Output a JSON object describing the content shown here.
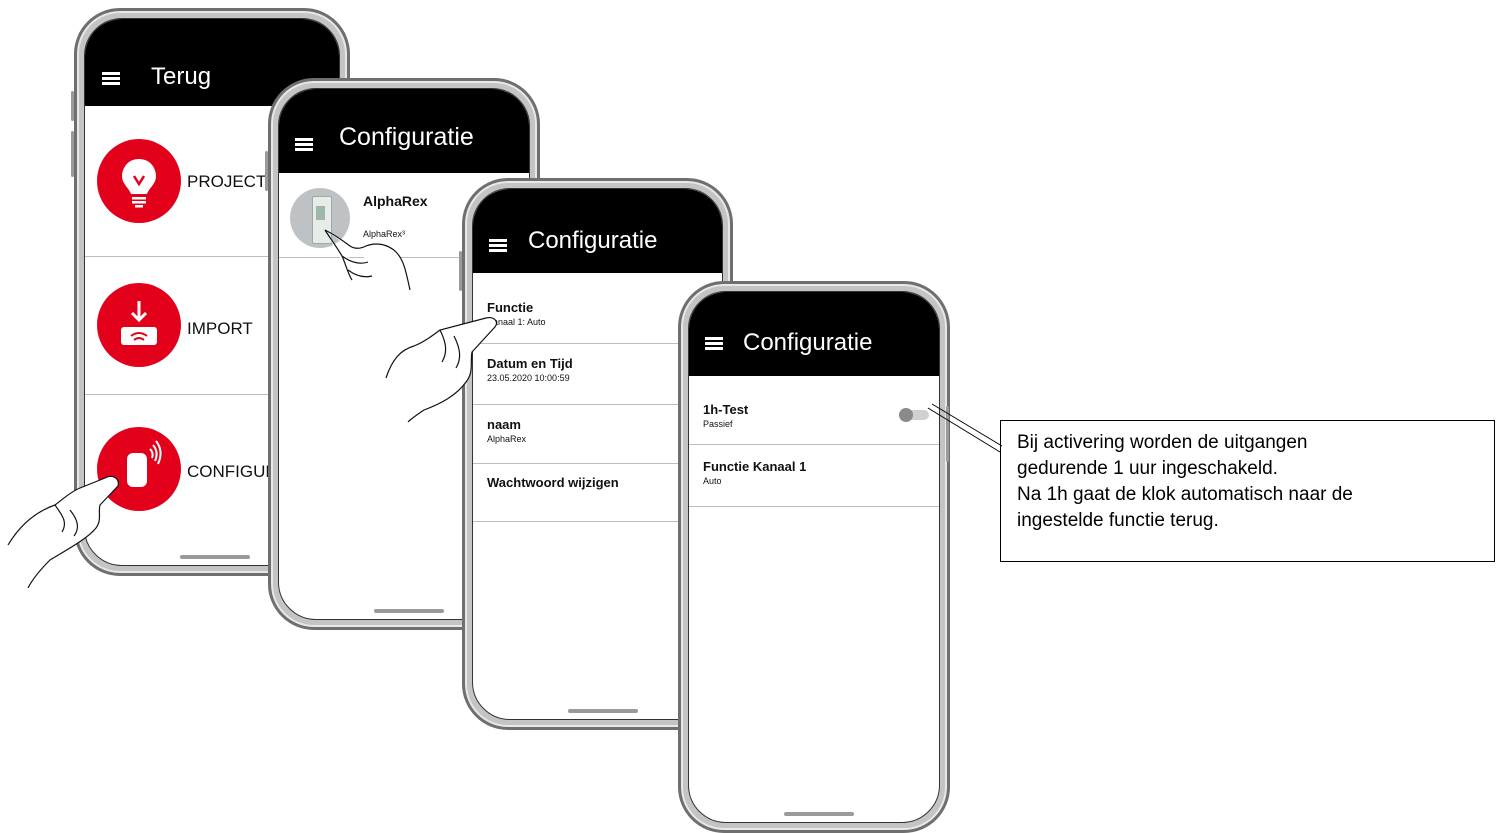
{
  "phone1": {
    "title": "Terug",
    "items": [
      {
        "label": "PROJECTEN",
        "icon": "lightbulb-icon"
      },
      {
        "label": "IMPORT",
        "icon": "download-router-icon"
      },
      {
        "label": "CONFIGURATIE",
        "icon": "remote-device-icon"
      }
    ]
  },
  "phone2": {
    "title": "Configuratie",
    "device": {
      "name": "AlphaRex",
      "subtitle": "AlphaRex³"
    }
  },
  "phone3": {
    "title": "Configuratie",
    "rows": [
      {
        "title": "Functie",
        "value": "Kanaal 1: Auto"
      },
      {
        "title": "Datum en Tijd",
        "value": "23.05.2020 10:00:59"
      },
      {
        "title": "naam",
        "value": "AlphaRex"
      },
      {
        "title": "Wachtwoord wijzigen",
        "value": ""
      }
    ]
  },
  "phone4": {
    "title": "Configuratie",
    "rows": [
      {
        "title": "1h-Test",
        "value": "Passief",
        "toggle": false
      },
      {
        "title": "Functie Kanaal 1",
        "value": "Auto"
      }
    ]
  },
  "callout": {
    "lines": [
      "Bij activering worden de uitgangen",
      "gedurende 1 uur ingeschakeld.",
      "Na 1h gaat de klok automatisch naar de",
      "ingestelde functie terug."
    ]
  },
  "colors": {
    "accent": "#e3001b",
    "appbar": "#000000"
  }
}
